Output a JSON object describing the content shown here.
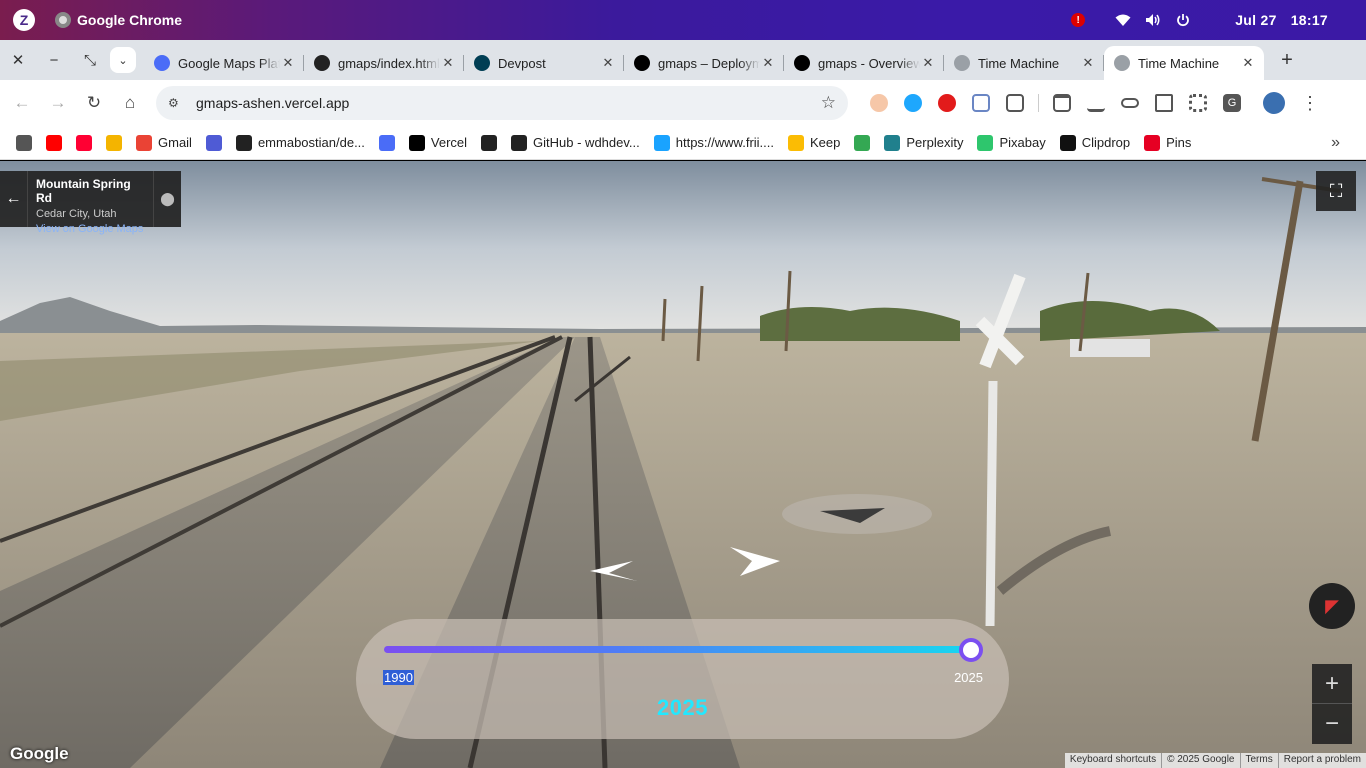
{
  "os": {
    "app_name": "Google Chrome",
    "date": "Jul 27",
    "time": "18:17"
  },
  "tabs": [
    {
      "title": "Google Maps Platform",
      "favicon": "maps-icon",
      "color": "#4a6cf7",
      "active": false
    },
    {
      "title": "gmaps/index.html",
      "favicon": "github-icon",
      "color": "#222222",
      "active": false
    },
    {
      "title": "Devpost",
      "favicon": "devpost-icon",
      "color": "#003e54",
      "active": false
    },
    {
      "title": "gmaps – Deployment",
      "favicon": "vercel-icon",
      "color": "#000000",
      "active": false
    },
    {
      "title": "gmaps - Overview",
      "favicon": "vercel-icon",
      "color": "#000000",
      "active": false
    },
    {
      "title": "Time Machine",
      "favicon": "globe-icon",
      "color": "#9aa0a6",
      "active": false
    },
    {
      "title": "Time Machine",
      "favicon": "globe-icon",
      "color": "#9aa0a6",
      "active": true
    }
  ],
  "toolbar": {
    "url": "gmaps-ashen.vercel.app"
  },
  "bookmarks": [
    {
      "label": "",
      "icon": "apps-grid-icon",
      "color": "#555555"
    },
    {
      "label": "",
      "icon": "youtube-icon",
      "color": "#ff0000"
    },
    {
      "label": "",
      "icon": "youtube-music-icon",
      "color": "#ff0033"
    },
    {
      "label": "",
      "icon": "google-drive-icon",
      "color": "#f4b400"
    },
    {
      "label": "Gmail",
      "icon": "gmail-icon",
      "color": "#ea4335"
    },
    {
      "label": "",
      "icon": "code-icon",
      "color": "#4f5bd5"
    },
    {
      "label": "emmabostian/de...",
      "icon": "github-icon",
      "color": "#222222"
    },
    {
      "label": "",
      "icon": "maps-icon",
      "color": "#4a6cf7"
    },
    {
      "label": "Vercel",
      "icon": "vercel-icon",
      "color": "#000000"
    },
    {
      "label": "",
      "icon": "github-icon",
      "color": "#222222"
    },
    {
      "label": "GitHub - wdhdev...",
      "icon": "github-icon",
      "color": "#222222"
    },
    {
      "label": "https://www.frii....",
      "icon": "frii-icon",
      "color": "#1aa3ff"
    },
    {
      "label": "Keep",
      "icon": "keep-icon",
      "color": "#fbbc04"
    },
    {
      "label": "",
      "icon": "photos-icon",
      "color": "#34a853"
    },
    {
      "label": "Perplexity",
      "icon": "perplexity-icon",
      "color": "#20808d"
    },
    {
      "label": "Pixabay",
      "icon": "pixabay-icon",
      "color": "#2ec66d"
    },
    {
      "label": "Clipdrop",
      "icon": "clipdrop-icon",
      "color": "#111111"
    },
    {
      "label": "Pins",
      "icon": "pinterest-icon",
      "color": "#e60023"
    }
  ],
  "streetview": {
    "title": "Mountain Spring Rd",
    "subtitle": "Cedar City, Utah",
    "link": "View on Google Maps",
    "logo": "Google",
    "attribution": [
      "Keyboard shortcuts",
      "© 2025 Google",
      "Terms",
      "Report a problem"
    ],
    "zoom_in": "+",
    "zoom_out": "−"
  },
  "time_slider": {
    "min": "1990",
    "max": "2025",
    "current": "2025",
    "value_fraction": 1.0
  }
}
